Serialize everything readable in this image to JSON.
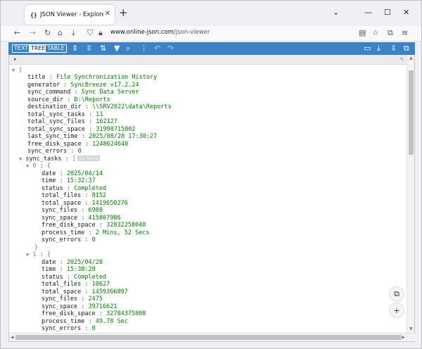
{
  "browser": {
    "tab_favicon": "{}",
    "tab_title": "JSON Viewer - Explore and Vie",
    "url_host": "www.online-json.com",
    "url_path": "/json-viewer"
  },
  "toolbar": {
    "modes": [
      "TEXT",
      "TREE",
      "TABLE"
    ],
    "active_mode": "TREE"
  },
  "icons": {
    "tab_close": "close-icon",
    "new_tab": "plus-icon",
    "minimize": "minimize-icon",
    "maximize": "maximize-icon",
    "window_close": "close-icon",
    "back": "arrow-left-icon",
    "forward": "arrow-right-icon",
    "reload": "reload-icon",
    "home": "home-icon",
    "save_pocket": "pocket-icon",
    "shield": "shield-icon",
    "lock": "lock-icon",
    "reader": "reader-view-icon",
    "bookmark": "star-icon",
    "extensions": "extensions-icon",
    "menu": "hamburger-icon"
  },
  "json": {
    "title": "File Synchronization History",
    "generator": "SyncBreeze v17.2.24",
    "sync_command": "Sync Data Server",
    "source_dir": "D:\\Reports",
    "destination_dir": "\\\\SRV2022\\data\\Reports",
    "total_sync_tasks": "11",
    "total_sync_files": "162127",
    "total_sync_space": "31998715002",
    "last_sync_time": "2025/08/28 17:30:27",
    "free_disk_space": "1248624640",
    "sync_errors": "0",
    "sync_tasks_count": "11 items",
    "tasks": [
      {
        "index": "0",
        "date": "2025/04/14",
        "time": "15:32:37",
        "status": "Completed",
        "total_files": "8152",
        "total_space": "1419650276",
        "sync_files": "6988",
        "sync_space": "415807986",
        "free_disk_space": "32832258048",
        "process_time": "2 Mins, 52 Secs",
        "sync_errors": "0"
      },
      {
        "index": "1",
        "date": "2025/04/28",
        "time": "15:38:28",
        "status": "Completed",
        "total_files": "10627",
        "total_space": "1459366897",
        "sync_files": "2475",
        "sync_space": "39716621",
        "free_disk_space": "32784375808",
        "process_time": "49.78 Sec",
        "sync_errors": "0"
      }
    ]
  }
}
